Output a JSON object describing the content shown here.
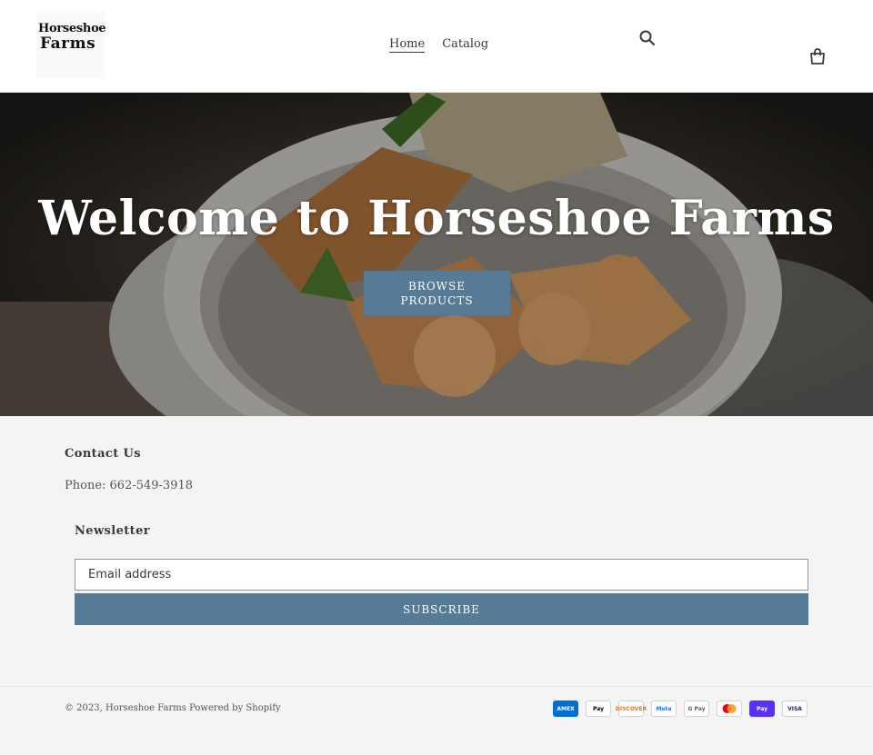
{
  "brand": {
    "line1": "Horseshoe",
    "line2": "Farms"
  },
  "nav": {
    "items": [
      {
        "label": "Home"
      },
      {
        "label": "Catalog"
      }
    ]
  },
  "hero": {
    "title": "Welcome to Horseshoe Farms",
    "button_label": "BROWSE PRODUCTS"
  },
  "contact": {
    "title": "Contact Us",
    "phone": "Phone: 662-549-3918"
  },
  "newsletter": {
    "title": "Newsletter",
    "placeholder": "Email address",
    "button_label": "SUBSCRIBE"
  },
  "footer": {
    "copyright_prefix": "© 2023,",
    "store_name": "Horseshoe Farms",
    "powered_by": "Powered by Shopify"
  },
  "payments": [
    {
      "name": "amex-icon",
      "label": "AMEX",
      "bg": "#016fd0",
      "color": "#ffffff"
    },
    {
      "name": "apple-pay-icon",
      "label": "Pay",
      "bg": "#ffffff",
      "color": "#000000"
    },
    {
      "name": "discover-icon",
      "label": "DISCOVER",
      "bg": "#ffffff",
      "color": "#e8760f"
    },
    {
      "name": "meta-pay-icon",
      "label": "Meta",
      "bg": "#ffffff",
      "color": "#1877f2"
    },
    {
      "name": "google-pay-icon",
      "label": "G Pay",
      "bg": "#ffffff",
      "color": "#5f6368"
    },
    {
      "name": "mastercard-icon",
      "label": "",
      "bg": "#ffffff",
      "color": "#000000"
    },
    {
      "name": "shop-pay-icon",
      "label": "Pay",
      "bg": "#5a31f4",
      "color": "#ffffff"
    },
    {
      "name": "visa-icon",
      "label": "VISA",
      "bg": "#ffffff",
      "color": "#1a1f71"
    }
  ],
  "colors": {
    "accent": "#557b97",
    "footer_bg": "#f4f4f4"
  }
}
